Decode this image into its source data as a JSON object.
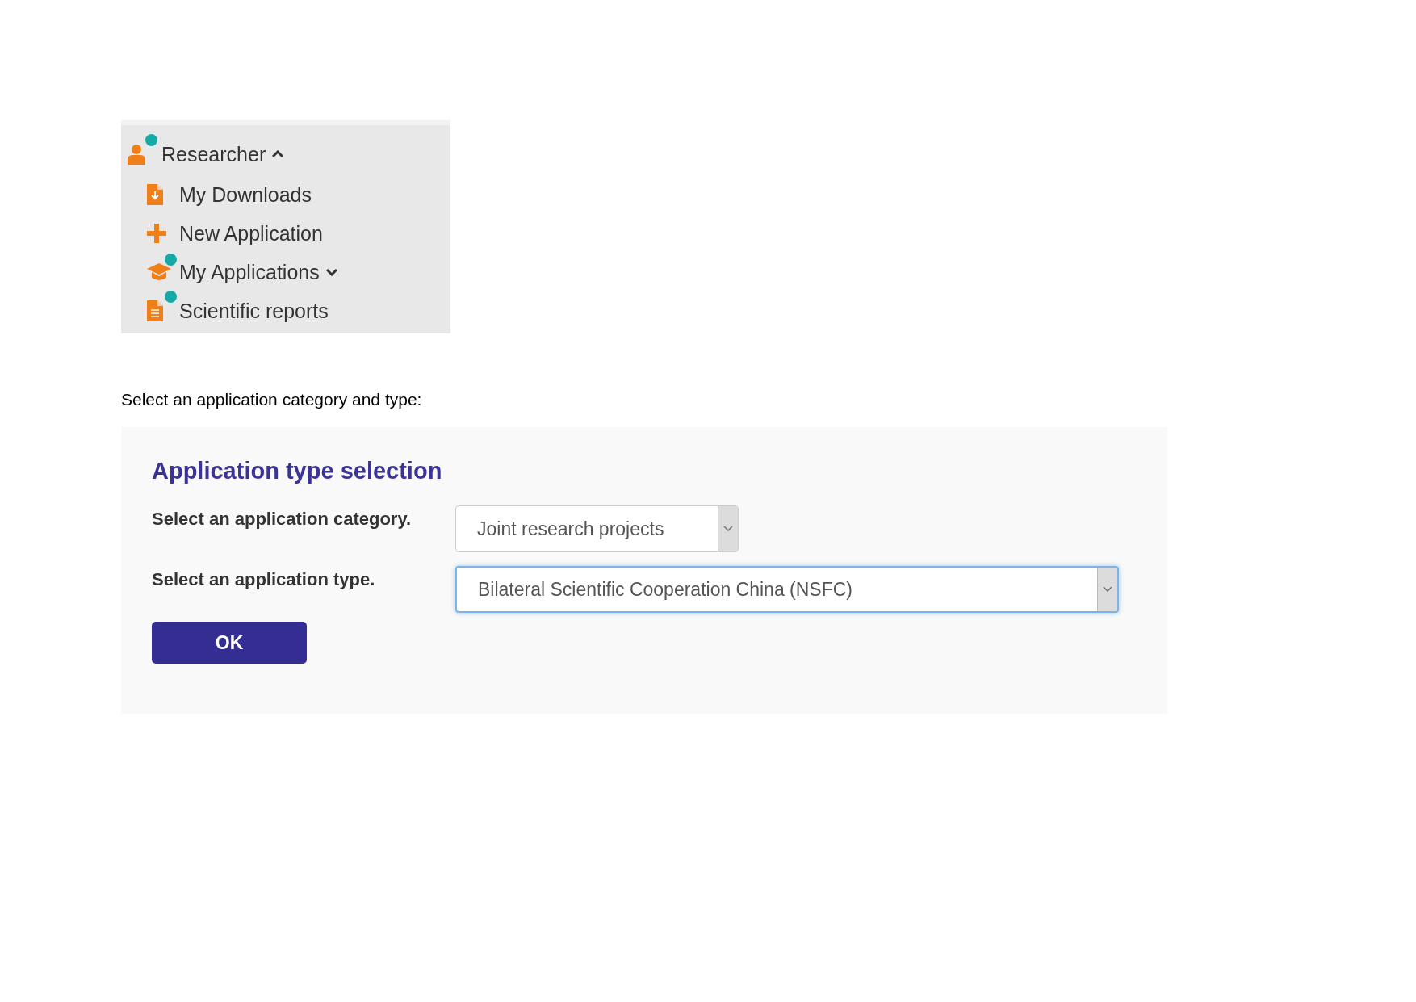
{
  "menu": {
    "header": {
      "label": "Researcher",
      "badge": true,
      "expanded": true
    },
    "items": [
      {
        "kind": "download",
        "label": "My Downloads",
        "badge": false
      },
      {
        "kind": "plus",
        "label": "New Application",
        "badge": false
      },
      {
        "kind": "cap",
        "label": "My Applications",
        "badge": true,
        "expanded": false
      },
      {
        "kind": "report",
        "label": "Scientific reports",
        "badge": true
      }
    ]
  },
  "caption": "Select an application category and type:",
  "form": {
    "title": "Application type selection",
    "fields": [
      {
        "label": "Select an application category.",
        "value": "Joint research projects",
        "focused": false,
        "wide": false
      },
      {
        "label": "Select an application type.",
        "value": "Bilateral Scientific Cooperation China (NSFC)",
        "focused": true,
        "wide": true
      }
    ],
    "button": "OK"
  }
}
